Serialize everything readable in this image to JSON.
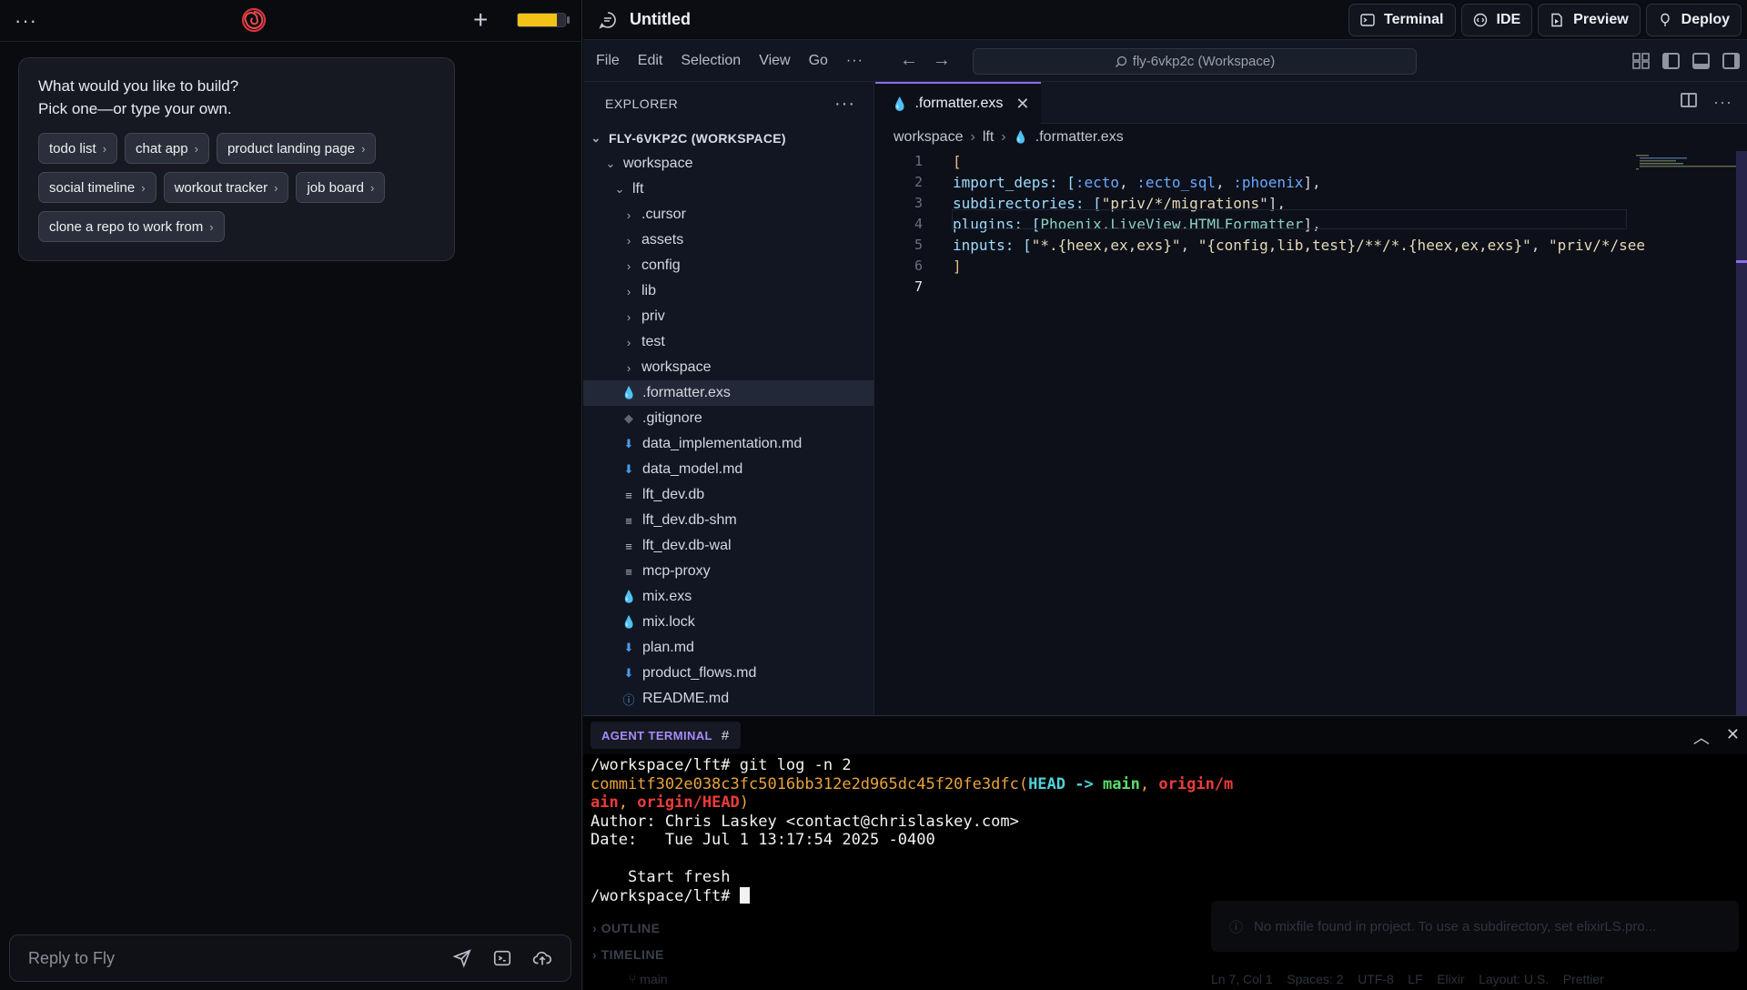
{
  "chat": {
    "prompt_line1": "What would you like to build?",
    "prompt_line2": "Pick one—or type your own.",
    "suggestions": [
      "todo list",
      "chat app",
      "product landing page",
      "social timeline",
      "workout tracker",
      "job board",
      "clone a repo to work from"
    ],
    "reply_placeholder": "Reply to Fly",
    "battery_level": 0.82,
    "accent_color": "#f2c316"
  },
  "ide": {
    "title": "Untitled",
    "buttons": [
      "Terminal",
      "IDE",
      "Preview",
      "Deploy"
    ],
    "menu": [
      "File",
      "Edit",
      "Selection",
      "View",
      "Go"
    ],
    "search": "fly-6vkp2c (Workspace)",
    "explorer_label": "EXPLORER",
    "tree": [
      {
        "label": "FLY-6VKP2C (WORKSPACE)",
        "icon": "chevron-down",
        "type": "root"
      },
      {
        "label": "workspace",
        "icon": "chevron-down",
        "type": "folder"
      },
      {
        "label": "lft",
        "icon": "chevron-down",
        "type": "folder"
      },
      {
        "label": ".cursor",
        "icon": "chevron-right",
        "type": "folder"
      },
      {
        "label": "assets",
        "icon": "chevron-right",
        "type": "folder"
      },
      {
        "label": "config",
        "icon": "chevron-right",
        "type": "folder"
      },
      {
        "label": "lib",
        "icon": "chevron-right",
        "type": "folder"
      },
      {
        "label": "priv",
        "icon": "chevron-right",
        "type": "folder"
      },
      {
        "label": "test",
        "icon": "chevron-right",
        "type": "folder"
      },
      {
        "label": "workspace",
        "icon": "chevron-right",
        "type": "folder"
      },
      {
        "label": ".formatter.exs",
        "icon": "elixir",
        "type": "file",
        "selected": true
      },
      {
        "label": ".gitignore",
        "icon": "git",
        "type": "file"
      },
      {
        "label": "data_implementation.md",
        "icon": "markdown",
        "type": "file"
      },
      {
        "label": "data_model.md",
        "icon": "markdown",
        "type": "file"
      },
      {
        "label": "lft_dev.db",
        "icon": "lines",
        "type": "file"
      },
      {
        "label": "lft_dev.db-shm",
        "icon": "lines",
        "type": "file"
      },
      {
        "label": "lft_dev.db-wal",
        "icon": "lines",
        "type": "file"
      },
      {
        "label": "mcp-proxy",
        "icon": "lines",
        "type": "file"
      },
      {
        "label": "mix.exs",
        "icon": "elixir",
        "type": "file"
      },
      {
        "label": "mix.lock",
        "icon": "drop",
        "type": "file"
      },
      {
        "label": "plan.md",
        "icon": "markdown",
        "type": "file"
      },
      {
        "label": "product_flows.md",
        "icon": "markdown",
        "type": "file"
      },
      {
        "label": "README.md",
        "icon": "info",
        "type": "file"
      }
    ],
    "tab": ".formatter.exs",
    "breadcrumbs": [
      "workspace",
      "lft",
      ".formatter.exs"
    ],
    "code_lines": [
      {
        "n": "1",
        "html": "[",
        "parts": [
          {
            "t": "[",
            "c": "#e5c07b"
          }
        ]
      },
      {
        "n": "2",
        "parts": [
          {
            "t": "  import_deps: [",
            "c": "#9cdcfe"
          },
          {
            "t": ":ecto",
            "c": "#6aa8ff"
          },
          {
            "t": ", ",
            "c": "#d4d4d4"
          },
          {
            "t": ":ecto_sql",
            "c": "#6aa8ff"
          },
          {
            "t": ", ",
            "c": "#d4d4d4"
          },
          {
            "t": ":phoenix",
            "c": "#6aa8ff"
          },
          {
            "t": "],",
            "c": "#d4d4d4"
          }
        ]
      },
      {
        "n": "3",
        "parts": [
          {
            "t": "  subdirectories: [",
            "c": "#9cdcfe"
          },
          {
            "t": "\"priv/*/migrations\"",
            "c": "#e5d9b8"
          },
          {
            "t": "],",
            "c": "#d4d4d4"
          }
        ]
      },
      {
        "n": "4",
        "parts": [
          {
            "t": "  plugins: [",
            "c": "#9cdcfe"
          },
          {
            "t": "Phoenix.LiveView.HTMLFormatter",
            "c": "#8ad0c2"
          },
          {
            "t": "],",
            "c": "#d4d4d4"
          }
        ]
      },
      {
        "n": "5",
        "parts": [
          {
            "t": "  inputs: [",
            "c": "#9cdcfe"
          },
          {
            "t": "\"*.{heex,ex,exs}\"",
            "c": "#e5d9b8"
          },
          {
            "t": ", ",
            "c": "#d4d4d4"
          },
          {
            "t": "\"{config,lib,test}/**/*.{heex,ex,exs}\"",
            "c": "#e5d9b8"
          },
          {
            "t": ", ",
            "c": "#d4d4d4"
          },
          {
            "t": "\"priv/*/see",
            "c": "#e5d9b8"
          }
        ]
      },
      {
        "n": "6",
        "parts": [
          {
            "t": "]",
            "c": "#e5c07b"
          }
        ]
      },
      {
        "n": "7",
        "parts": []
      }
    ],
    "terminal": {
      "tab": "AGENT TERMINAL",
      "tab_hash": "#",
      "lines": [
        [
          {
            "t": "/workspace/lft# git log -n 2",
            "c": ""
          }
        ],
        [
          {
            "t": "commitf302e038c3fc5016bb312e2d965dc45f20fe3dfc",
            "c": "c-orange"
          },
          {
            "t": "(",
            "c": "c-orange"
          },
          {
            "t": "HEAD -> ",
            "c": "c-cyan"
          },
          {
            "t": "main",
            "c": "c-green"
          },
          {
            "t": ", ",
            "c": "c-orange"
          },
          {
            "t": "origin/m",
            "c": "c-red"
          }
        ],
        [
          {
            "t": "ain",
            "c": "c-red"
          },
          {
            "t": ", ",
            "c": "c-orange"
          },
          {
            "t": "origin/HEAD",
            "c": "c-red"
          },
          {
            "t": ")",
            "c": "c-orange"
          }
        ],
        [
          {
            "t": "Author: Chris Laskey <contact@chrislaskey.com>",
            "c": ""
          }
        ],
        [
          {
            "t": "Date:   Tue Jul 1 13:17:54 2025 -0400",
            "c": ""
          }
        ],
        [
          {
            "t": " ",
            "c": ""
          }
        ],
        [
          {
            "t": "    Start fresh",
            "c": ""
          }
        ],
        [
          {
            "t": "/workspace/lft# ",
            "c": ""
          }
        ]
      ]
    },
    "faded": {
      "outline": "OUTLINE",
      "timeline": "TIMELINE",
      "notice": "No mixfile found in project. To use a subdirectory, set  elixirLS.pro...",
      "status": "Ln 7, Col 1    Spaces: 2    UTF-8    LF    Elixir    Layout: U.S.    Prettier",
      "branch": "main"
    }
  }
}
